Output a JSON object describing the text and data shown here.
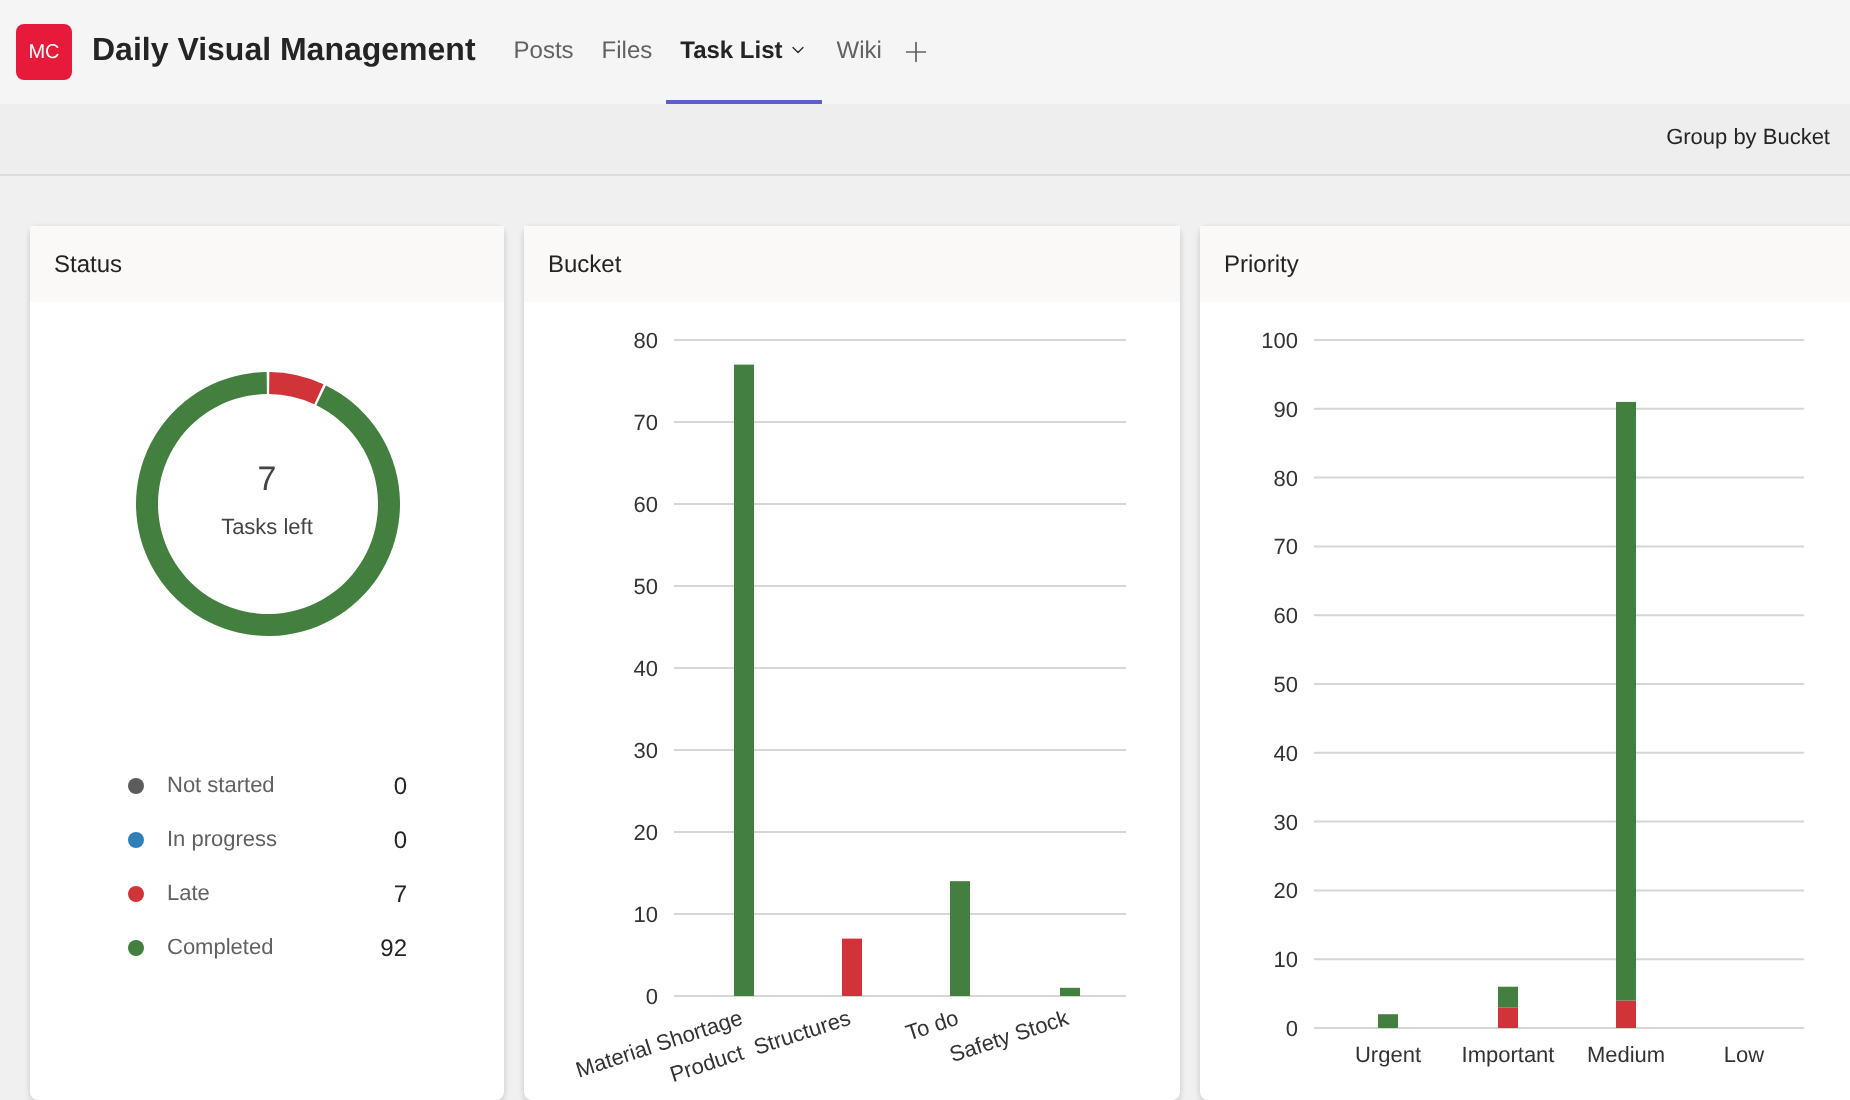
{
  "team": {
    "avatar": "MC",
    "title": "Daily Visual Management"
  },
  "tabs": [
    {
      "label": "Posts",
      "selected": false
    },
    {
      "label": "Files",
      "selected": false
    },
    {
      "label": "Task List",
      "selected": true
    },
    {
      "label": "Wiki",
      "selected": false
    }
  ],
  "toolbar": {
    "group_by": "Group by Bucket"
  },
  "status": {
    "title": "Status",
    "center_value": "7",
    "center_label": "Tasks left",
    "legend": [
      {
        "count": "0",
        "color": "#5c5c5c"
      },
      {
        "count": "0",
        "color": "#2f7fb8"
      },
      {
        "count": "7",
        "color": "#d13438"
      },
      {
        "count": "92",
        "color": "#437f3f"
      }
    ],
    "chart_data": {
      "type": "donut",
      "categories": [
        "Not started",
        "In progress",
        "Late",
        "Completed"
      ],
      "values": [
        0,
        0,
        7,
        92
      ]
    }
  },
  "bucket": {
    "title": "Bucket",
    "chart_data": {
      "type": "bar",
      "stacked": true,
      "grid": true,
      "categories": [
        "Material Shortage",
        "Product  Structures",
        "To do",
        "Safety Stock"
      ],
      "series": [
        {
          "color": "#d13438",
          "values": [
            0,
            7,
            0,
            0
          ]
        },
        {
          "color": "#437f3f",
          "values": [
            77,
            0,
            14,
            1
          ]
        }
      ],
      "ylim": [
        0,
        80
      ],
      "yticks": [
        0,
        10,
        20,
        30,
        40,
        50,
        60,
        70,
        80
      ]
    }
  },
  "priority": {
    "title": "Priority",
    "chart_data": {
      "type": "bar",
      "stacked": true,
      "grid": true,
      "categories": [
        "Urgent",
        "Important",
        "Medium",
        "Low"
      ],
      "series": [
        {
          "color": "#d13438",
          "values": [
            0,
            3,
            4,
            0
          ]
        },
        {
          "color": "#437f3f",
          "values": [
            2,
            3,
            87,
            0
          ]
        }
      ],
      "ylim": [
        0,
        100
      ],
      "yticks": [
        0,
        10,
        20,
        30,
        40,
        50,
        60,
        70,
        80,
        90,
        100
      ]
    }
  }
}
